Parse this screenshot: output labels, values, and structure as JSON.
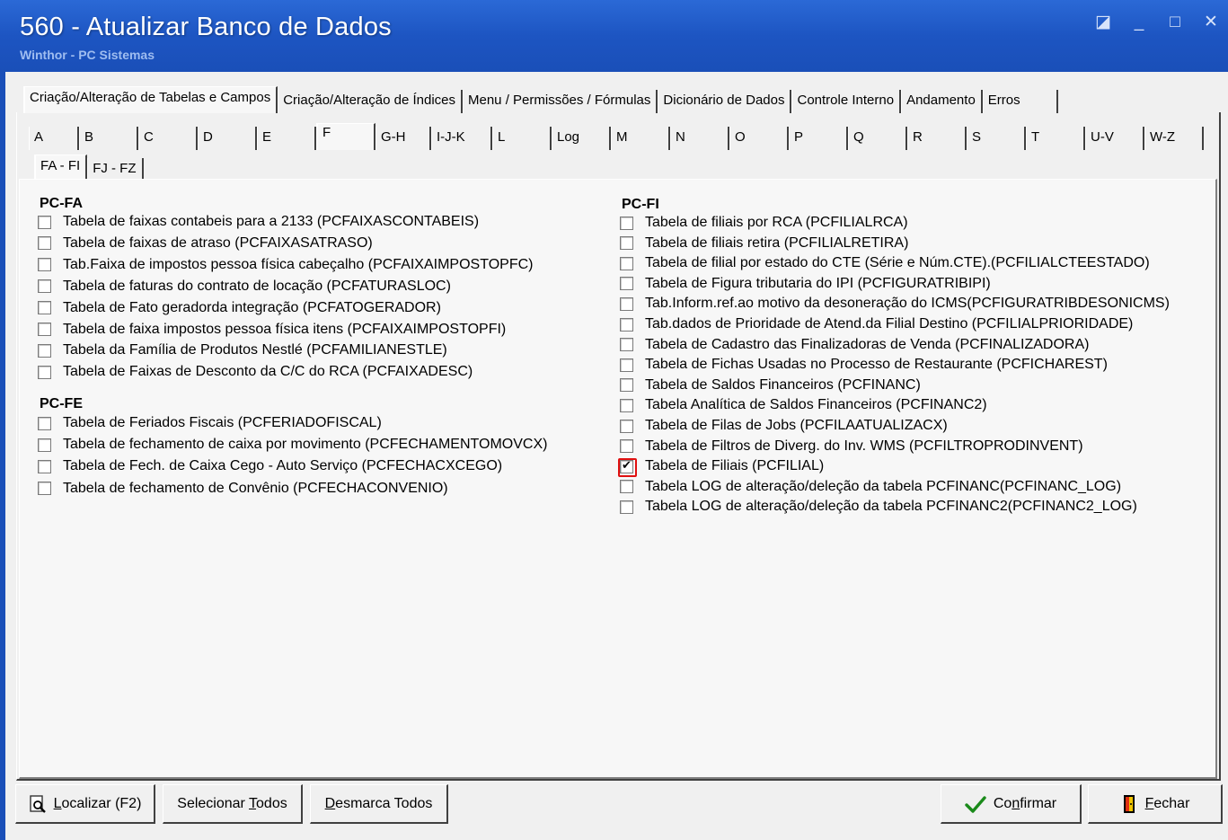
{
  "window": {
    "title": "560 - Atualizar Banco de Dados",
    "subtitle": "Winthor - PC Sistemas",
    "controls": [
      "◪",
      "_",
      "□",
      "✕"
    ]
  },
  "main_tabs": [
    "Criação/Alteração de Tabelas e Campos",
    "Criação/Alteração de Índices",
    "Menu / Permissões / Fórmulas",
    "Dicionário de Dados",
    "Controle Interno",
    "Andamento",
    "Erros"
  ],
  "letter_tabs": [
    "A",
    "B",
    "C",
    "D",
    "E",
    "F",
    "G-H",
    "I-J-K",
    "L",
    "Log",
    "M",
    "N",
    "O",
    "P",
    "Q",
    "R",
    "S",
    "T",
    "U-V",
    "W-Z"
  ],
  "sub_tabs": [
    "FA - FI",
    "FJ - FZ"
  ],
  "groups": {
    "pcfa": {
      "title": "PC-FA",
      "items": [
        "Tabela de faixas contabeis para a 2133 (PCFAIXASCONTABEIS)",
        "Tabela de faixas de atraso (PCFAIXASATRASO)",
        "Tab.Faixa de impostos pessoa física cabeçalho (PCFAIXAIMPOSTOPFC)",
        "Tabela de faturas do contrato de locação (PCFATURASLOC)",
        "Tabela de Fato geradorda integração (PCFATOGERADOR)",
        "Tabela de faixa impostos pessoa física itens (PCFAIXAIMPOSTOPFI)",
        "Tabela da Família de Produtos Nestlé (PCFAMILIANESTLE)",
        "Tabela de Faixas de Desconto da C/C do RCA (PCFAIXADESC)"
      ]
    },
    "pcfe": {
      "title": "PC-FE",
      "items": [
        "Tabela de Feriados Fiscais (PCFERIADOFISCAL)",
        "Tabela de fechamento de caixa por movimento (PCFECHAMENTOMOVCX)",
        "Tabela de Fech. de Caixa Cego - Auto Serviço (PCFECHACXCEGO)",
        "Tabela de fechamento de Convênio (PCFECHACONVENIO)"
      ]
    },
    "pcfi": {
      "title": "PC-FI",
      "items": [
        "Tabela de filiais por RCA (PCFILIALRCA)",
        "Tabela de filiais retira (PCFILIALRETIRA)",
        "Tabela de filial por estado do CTE (Série e Núm.CTE).(PCFILIALCTEESTADO)",
        "Tabela de Figura tributaria do IPI (PCFIGURATRIBIPI)",
        "Tab.Inform.ref.ao motivo da desoneração do ICMS(PCFIGURATRIBDESONICMS)",
        "Tab.dados de Prioridade de Atend.da Filial Destino (PCFILIALPRIORIDADE)",
        "Tabela de Cadastro das Finalizadoras de Venda (PCFINALIZADORA)",
        "Tabela de Fichas Usadas no Processo de Restaurante (PCFICHAREST)",
        "Tabela de Saldos Financeiros (PCFINANC)",
        "Tabela Analítica de Saldos Financeiros (PCFINANC2)",
        "Tabela de Filas de Jobs (PCFILAATUALIZACX)",
        "Tabela de Filtros de Diverg. do Inv. WMS (PCFILTROPRODINVENT)",
        "Tabela de Filiais (PCFILIAL)",
        "Tabela LOG de alteração/deleção da tabela PCFINANC(PCFINANC_LOG)",
        "Tabela LOG de alteração/deleção da tabela PCFINANC2(PCFINANC2_LOG)"
      ],
      "checked_index": 12
    }
  },
  "buttons": {
    "localizar": {
      "u": "L",
      "rest": "ocalizar (F2)"
    },
    "selecionar": {
      "pre": "Selecionar ",
      "u": "T",
      "rest": "odos"
    },
    "desmarca": {
      "u": "D",
      "rest": "esmarca Todos"
    },
    "confirmar": {
      "pre": "Co",
      "u": "n",
      "rest": "firmar"
    },
    "fechar": {
      "u": "F",
      "rest": "echar"
    }
  },
  "colors": {
    "titlebar": "#1d55c2",
    "highlight": "#e01010",
    "confirm_check": "#1a8a1a"
  }
}
